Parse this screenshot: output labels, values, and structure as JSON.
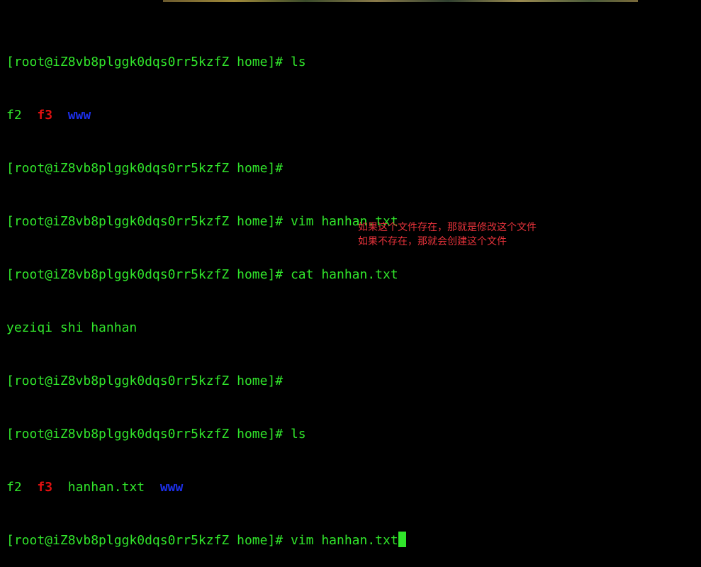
{
  "terminal": {
    "lines": [
      {
        "prompt": "[root@iZ8vb8plggk0dqs0rr5kzfZ home]# ",
        "command": "ls"
      },
      {
        "items": [
          {
            "text": "f2",
            "color": "#31e52b"
          },
          {
            "text": "f3",
            "color": "#e01010"
          },
          {
            "text": "www",
            "color": "#1c2fe8"
          }
        ]
      },
      {
        "prompt": "[root@iZ8vb8plggk0dqs0rr5kzfZ home]#",
        "command": ""
      },
      {
        "prompt": "[root@iZ8vb8plggk0dqs0rr5kzfZ home]# ",
        "command": "vim hanhan.txt"
      },
      {
        "prompt": "[root@iZ8vb8plggk0dqs0rr5kzfZ home]# ",
        "command": "cat hanhan.txt"
      },
      {
        "output": "yeziqi shi hanhan"
      },
      {
        "prompt": "[root@iZ8vb8plggk0dqs0rr5kzfZ home]#",
        "command": ""
      },
      {
        "prompt": "[root@iZ8vb8plggk0dqs0rr5kzfZ home]# ",
        "command": "ls"
      },
      {
        "items": [
          {
            "text": "f2",
            "color": "#31e52b"
          },
          {
            "text": "f3",
            "color": "#e01010"
          },
          {
            "text": "hanhan.txt",
            "color": "#31e52b"
          },
          {
            "text": "www",
            "color": "#1c2fe8"
          }
        ]
      },
      {
        "prompt": "[root@iZ8vb8plggk0dqs0rr5kzfZ home]# ",
        "command": "vim hanhan.txt"
      }
    ]
  },
  "annotation": {
    "line1": "如果这个文件存在，那就是修改这个文件",
    "line2": "如果不存在，那就会创建这个文件"
  },
  "colors": {
    "background": "#000000",
    "terminal_text": "#31e52b",
    "executable": "#e01010",
    "directory": "#1c2fe8",
    "annotation": "#e5323a"
  }
}
